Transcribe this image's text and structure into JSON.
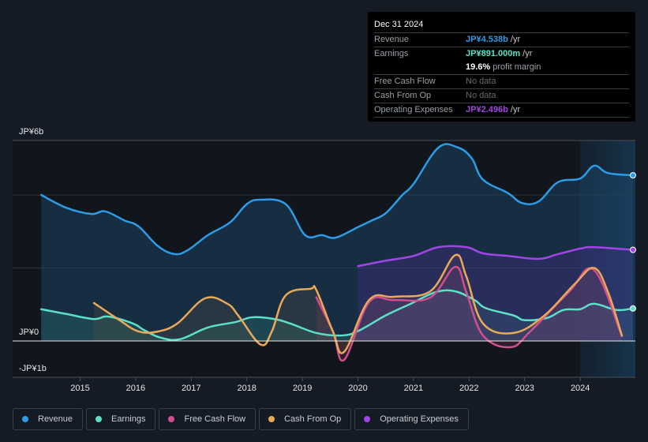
{
  "chart_data": {
    "type": "area",
    "title": "",
    "xlabel": "",
    "ylabel": "",
    "y_tick_labels": [
      "JP¥6b",
      "JP¥0",
      "-JP¥1b"
    ],
    "ylim": [
      -1,
      5.5
    ],
    "y_gridlines": [
      0,
      2,
      4
    ],
    "x_ticks": [
      2015,
      2016,
      2017,
      2018,
      2019,
      2020,
      2021,
      2022,
      2023,
      2024
    ],
    "xlim": [
      2014.2,
      2025.0
    ],
    "highlight_from": 2024.0,
    "grid": true,
    "legend_position": "bottom",
    "currency_unit": "JP¥ billions",
    "series": [
      {
        "name": "Revenue",
        "key": "revenue",
        "color": "#2d9be6",
        "end_marker": true,
        "points": [
          [
            2014.3,
            4.0
          ],
          [
            2014.75,
            3.65
          ],
          [
            2015.2,
            3.48
          ],
          [
            2015.45,
            3.55
          ],
          [
            2015.8,
            3.3
          ],
          [
            2016.05,
            3.14
          ],
          [
            2016.4,
            2.6
          ],
          [
            2016.7,
            2.38
          ],
          [
            2016.95,
            2.5
          ],
          [
            2017.3,
            2.9
          ],
          [
            2017.7,
            3.25
          ],
          [
            2018.0,
            3.75
          ],
          [
            2018.25,
            3.87
          ],
          [
            2018.7,
            3.75
          ],
          [
            2019.05,
            2.9
          ],
          [
            2019.35,
            2.9
          ],
          [
            2019.6,
            2.83
          ],
          [
            2020.0,
            3.12
          ],
          [
            2020.25,
            3.3
          ],
          [
            2020.5,
            3.5
          ],
          [
            2020.8,
            4.0
          ],
          [
            2021.0,
            4.3
          ],
          [
            2021.45,
            5.3
          ],
          [
            2021.8,
            5.3
          ],
          [
            2022.05,
            5.0
          ],
          [
            2022.25,
            4.42
          ],
          [
            2022.7,
            4.05
          ],
          [
            2022.95,
            3.78
          ],
          [
            2023.25,
            3.82
          ],
          [
            2023.6,
            4.35
          ],
          [
            2024.0,
            4.45
          ],
          [
            2024.25,
            4.8
          ],
          [
            2024.5,
            4.6
          ],
          [
            2024.95,
            4.538
          ]
        ]
      },
      {
        "name": "Earnings",
        "key": "earnings",
        "color": "#5de0c8",
        "end_marker": true,
        "points": [
          [
            2014.3,
            0.87
          ],
          [
            2014.75,
            0.74
          ],
          [
            2015.25,
            0.6
          ],
          [
            2015.5,
            0.67
          ],
          [
            2015.95,
            0.48
          ],
          [
            2016.15,
            0.3
          ],
          [
            2016.45,
            0.09
          ],
          [
            2016.8,
            0.05
          ],
          [
            2017.3,
            0.37
          ],
          [
            2017.8,
            0.52
          ],
          [
            2018.1,
            0.65
          ],
          [
            2018.5,
            0.6
          ],
          [
            2018.8,
            0.47
          ],
          [
            2019.25,
            0.22
          ],
          [
            2019.7,
            0.15
          ],
          [
            2020.0,
            0.27
          ],
          [
            2020.5,
            0.7
          ],
          [
            2020.95,
            1.02
          ],
          [
            2021.4,
            1.34
          ],
          [
            2021.75,
            1.36
          ],
          [
            2022.1,
            1.12
          ],
          [
            2022.3,
            0.9
          ],
          [
            2022.8,
            0.7
          ],
          [
            2023.0,
            0.57
          ],
          [
            2023.4,
            0.63
          ],
          [
            2023.7,
            0.85
          ],
          [
            2024.0,
            0.87
          ],
          [
            2024.25,
            1.02
          ],
          [
            2024.65,
            0.85
          ],
          [
            2024.95,
            0.891
          ]
        ]
      },
      {
        "name": "Free Cash Flow",
        "key": "fcf",
        "color": "#cf4f8f",
        "end_marker": false,
        "points": [
          [
            2019.25,
            1.2
          ],
          [
            2019.55,
            0.26
          ],
          [
            2019.75,
            -0.52
          ],
          [
            2020.2,
            1.06
          ],
          [
            2020.65,
            1.12
          ],
          [
            2021.3,
            1.19
          ],
          [
            2021.75,
            2.03
          ],
          [
            2021.95,
            1.34
          ],
          [
            2022.25,
            0.15
          ],
          [
            2022.75,
            -0.17
          ],
          [
            2023.1,
            0.26
          ],
          [
            2023.8,
            1.35
          ],
          [
            2024.25,
            1.94
          ],
          [
            2024.75,
            0.13
          ]
        ]
      },
      {
        "name": "Cash From Op",
        "key": "cfo",
        "color": "#e9a85a",
        "end_marker": false,
        "points": [
          [
            2015.25,
            1.04
          ],
          [
            2015.7,
            0.58
          ],
          [
            2016.05,
            0.26
          ],
          [
            2016.4,
            0.26
          ],
          [
            2016.75,
            0.48
          ],
          [
            2017.25,
            1.17
          ],
          [
            2017.65,
            1.02
          ],
          [
            2017.85,
            0.69
          ],
          [
            2018.25,
            -0.1
          ],
          [
            2018.45,
            0.26
          ],
          [
            2018.7,
            1.25
          ],
          [
            2019.15,
            1.43
          ],
          [
            2019.25,
            1.4
          ],
          [
            2019.55,
            0.26
          ],
          [
            2019.75,
            -0.3
          ],
          [
            2020.2,
            1.12
          ],
          [
            2020.65,
            1.21
          ],
          [
            2021.3,
            1.36
          ],
          [
            2021.75,
            2.35
          ],
          [
            2021.95,
            1.77
          ],
          [
            2022.25,
            0.48
          ],
          [
            2022.8,
            0.22
          ],
          [
            2023.35,
            0.69
          ],
          [
            2023.9,
            1.56
          ],
          [
            2024.25,
            2.0
          ],
          [
            2024.5,
            1.34
          ],
          [
            2024.75,
            0.15
          ]
        ]
      },
      {
        "name": "Operating Expenses",
        "key": "opex",
        "color": "#a146e6",
        "end_marker": true,
        "points": [
          [
            2020.0,
            2.05
          ],
          [
            2020.5,
            2.2
          ],
          [
            2021.0,
            2.33
          ],
          [
            2021.45,
            2.57
          ],
          [
            2021.95,
            2.57
          ],
          [
            2022.25,
            2.4
          ],
          [
            2022.7,
            2.33
          ],
          [
            2023.25,
            2.25
          ],
          [
            2023.6,
            2.38
          ],
          [
            2024.0,
            2.53
          ],
          [
            2024.25,
            2.57
          ],
          [
            2024.95,
            2.496
          ]
        ]
      }
    ]
  },
  "tooltip": {
    "date": "Dec 31 2024",
    "rows": [
      {
        "label": "Revenue",
        "value": "JP¥4.538b",
        "unit": " /yr",
        "color": "#2d9be6"
      },
      {
        "label": "Earnings",
        "value": "JP¥891.000m",
        "unit": " /yr",
        "color": "#5de0c8"
      },
      {
        "label": "",
        "margin_pct": "19.6%",
        "margin_text": " profit margin"
      },
      {
        "label": "Free Cash Flow",
        "nodata": "No data"
      },
      {
        "label": "Cash From Op",
        "nodata": "No data"
      },
      {
        "label": "Operating Expenses",
        "value": "JP¥2.496b",
        "unit": " /yr",
        "color": "#a146e6"
      }
    ]
  },
  "legend": [
    {
      "label": "Revenue",
      "color": "#2d9be6"
    },
    {
      "label": "Earnings",
      "color": "#5de0c8"
    },
    {
      "label": "Free Cash Flow",
      "color": "#cf4f8f"
    },
    {
      "label": "Cash From Op",
      "color": "#e9a85a"
    },
    {
      "label": "Operating Expenses",
      "color": "#a146e6"
    }
  ]
}
